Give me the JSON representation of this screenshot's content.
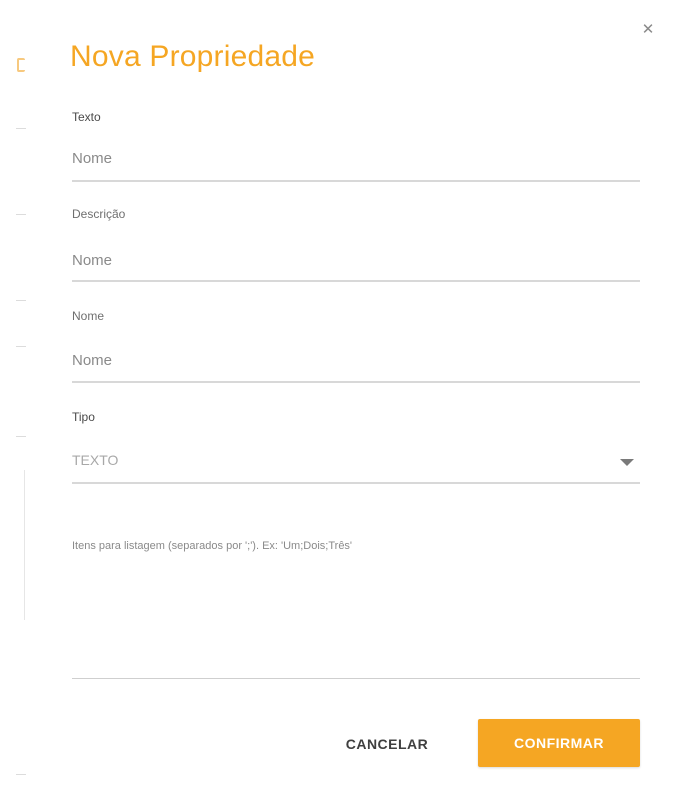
{
  "dialog": {
    "title": "Nova Propriedade",
    "close_icon": "close-icon",
    "accent_color": "#f5a623"
  },
  "fields": {
    "texto": {
      "label": "Texto",
      "value": "Nome"
    },
    "descricao": {
      "label": "Descrição",
      "value": "Nome"
    },
    "nome": {
      "label": "Nome",
      "value": "Nome"
    },
    "tipo": {
      "label": "Tipo",
      "value": "TEXTO",
      "icon": "dropdown-arrow-icon"
    },
    "itens": {
      "placeholder": "Itens para listagem (separados por ';'). Ex: 'Um;Dois;Três'"
    }
  },
  "actions": {
    "cancel_label": "CANCELAR",
    "confirm_label": "CONFIRMAR"
  }
}
